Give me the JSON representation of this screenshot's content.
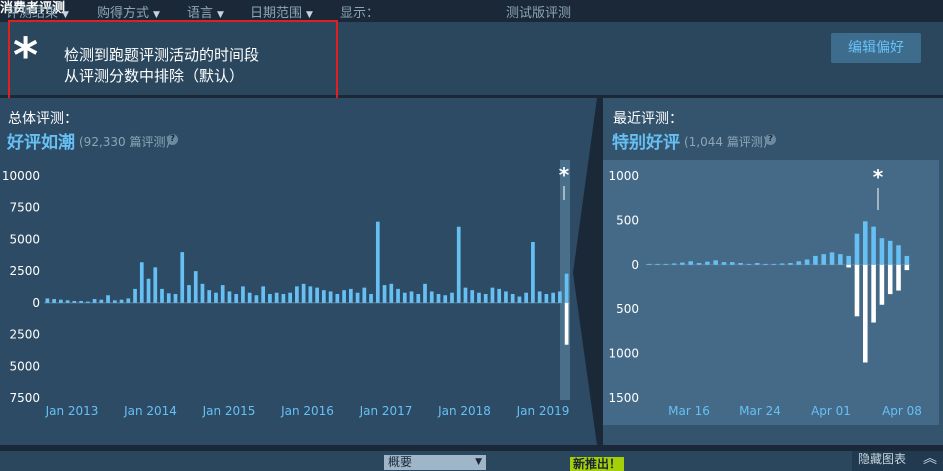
{
  "section_title": "消费者评测",
  "notice": {
    "line1": "检测到跑题评测活动的时间段",
    "line2": "从评测分数中排除（默认）",
    "edit_button": "编辑偏好"
  },
  "overall": {
    "label": "总体评测：",
    "score": "好评如潮",
    "count": "(92,330 篇评测)",
    "help": "?"
  },
  "recent": {
    "label": "最近评测：",
    "score": "特别好评",
    "count": "(1,044 篇评测)",
    "help": "?"
  },
  "filters": {
    "result": "评测结果",
    "purchase": "购得方式",
    "language": "语言",
    "date_range": "日期范围",
    "display_label": "显示：",
    "display_value": "概要",
    "beta": "测试版评测",
    "new_badge": "新推出！",
    "hide_graph": "隐藏图表"
  },
  "colors": {
    "positive": "#66c0f4",
    "negative": "#ffffff",
    "accent": "#67c1f5",
    "badge": "#a4d007"
  },
  "chart_data": [
    {
      "type": "bar",
      "name": "overall",
      "y_ticks_positive": [
        "10000",
        "7500",
        "5000",
        "2500",
        "0"
      ],
      "y_ticks_negative": [
        "2500",
        "5000",
        "7500"
      ],
      "ylim": [
        -7500,
        10000
      ],
      "x_tick_labels": [
        "Jan 2013",
        "Jan 2014",
        "Jan 2015",
        "Jan 2016",
        "Jan 2017",
        "Jan 2018",
        "Jan 2019"
      ],
      "positive": [
        350,
        300,
        250,
        200,
        150,
        150,
        100,
        300,
        250,
        600,
        200,
        250,
        350,
        1100,
        3200,
        1900,
        2800,
        1100,
        750,
        700,
        4000,
        1400,
        2500,
        1500,
        1000,
        800,
        1400,
        900,
        700,
        1300,
        800,
        600,
        1300,
        700,
        800,
        700,
        800,
        1300,
        1500,
        1300,
        1200,
        1000,
        900,
        700,
        1000,
        1100,
        800,
        1200,
        700,
        6400,
        1400,
        1500,
        1100,
        800,
        900,
        700,
        1500,
        900,
        700,
        600,
        800,
        6000,
        1200,
        1000,
        800,
        700,
        1200,
        1100,
        900,
        700,
        500,
        800,
        4800,
        900,
        700,
        800,
        900,
        2300
      ],
      "negative": [
        0,
        0,
        0,
        0,
        0,
        0,
        0,
        0,
        0,
        0,
        0,
        0,
        0,
        0,
        0,
        0,
        0,
        0,
        0,
        0,
        0,
        0,
        0,
        0,
        0,
        0,
        0,
        0,
        0,
        0,
        0,
        0,
        0,
        0,
        0,
        0,
        0,
        0,
        0,
        0,
        0,
        0,
        0,
        0,
        0,
        0,
        0,
        0,
        0,
        0,
        0,
        0,
        0,
        0,
        0,
        0,
        0,
        0,
        0,
        0,
        0,
        0,
        0,
        0,
        0,
        0,
        0,
        0,
        0,
        0,
        0,
        0,
        0,
        0,
        0,
        0,
        0,
        3300
      ],
      "annotation": "*"
    },
    {
      "type": "bar",
      "name": "recent",
      "y_ticks_positive": [
        "1000",
        "500",
        "0"
      ],
      "y_ticks_negative": [
        "500",
        "1000",
        "1500"
      ],
      "ylim": [
        -1500,
        1000
      ],
      "x_tick_labels": [
        "Mar 16",
        "Mar 24",
        "Apr 01",
        "Apr 08"
      ],
      "positive": [
        10,
        10,
        10,
        15,
        25,
        40,
        20,
        35,
        50,
        30,
        30,
        20,
        10,
        20,
        10,
        10,
        15,
        20,
        40,
        60,
        100,
        120,
        140,
        120,
        100,
        350,
        490,
        430,
        300,
        270,
        220,
        100
      ],
      "negative": [
        0,
        0,
        0,
        0,
        0,
        0,
        0,
        0,
        0,
        0,
        0,
        0,
        0,
        0,
        0,
        0,
        0,
        0,
        0,
        0,
        0,
        0,
        0,
        0,
        30,
        580,
        1100,
        650,
        450,
        330,
        290,
        60
      ],
      "annotation": "*"
    }
  ]
}
